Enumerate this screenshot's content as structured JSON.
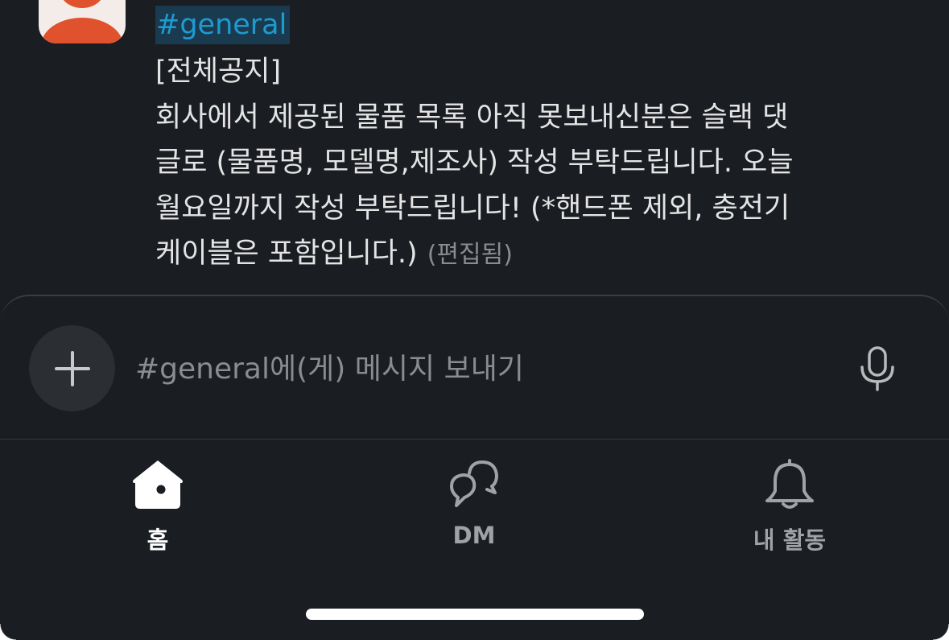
{
  "message": {
    "channel_tag": "#general",
    "lines": [
      "[전체공지]",
      "회사에서 제공된 물품 목록 아직 못보내신분은 슬랙 댓",
      "글로 (물품명, 모델명,제조사) 작성 부탁드립니다. 오늘",
      "월요일까지 작성 부탁드립니다! (*핸드폰 제외, 충전기",
      "케이블은 포함입니다.)"
    ],
    "edited_label": "(편집됨)"
  },
  "composer": {
    "placeholder": "#general에(게) 메시지 보내기",
    "add_icon": "plus-icon",
    "mic_icon": "microphone-icon"
  },
  "tabs": {
    "home": {
      "label": "홈",
      "icon": "home-icon",
      "active": true
    },
    "dm": {
      "label": "DM",
      "icon": "dm-icon",
      "active": false
    },
    "activity": {
      "label": "내 활동",
      "icon": "bell-icon",
      "active": false
    }
  },
  "colors": {
    "background": "#1a1d21",
    "link": "#1d9bd1",
    "link_highlight": "#1a3a4f",
    "avatar_orange": "#e0522e",
    "text": "#e4e4e5",
    "muted": "#8a8c90"
  }
}
